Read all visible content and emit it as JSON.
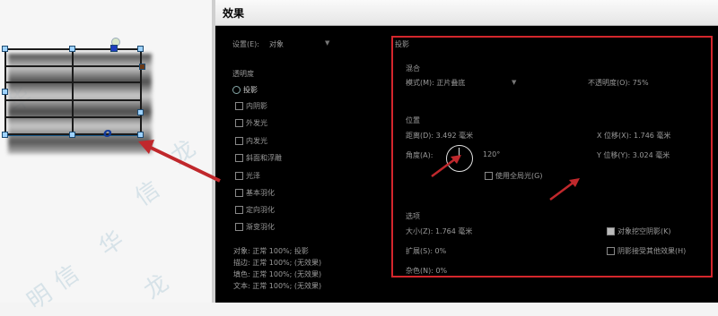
{
  "watermark": {
    "chars": [
      "华",
      "信",
      "龙",
      "华",
      "信",
      "明",
      "龙"
    ]
  },
  "dialog": {
    "title": "效果",
    "preset_label": "设置(E):",
    "preset_value": "对象",
    "left_section_label": "透明度",
    "effects": [
      "投影",
      "内阴影",
      "外发光",
      "内发光",
      "斜面和浮雕",
      "光泽",
      "基本羽化",
      "定向羽化",
      "渐变羽化"
    ],
    "summary_lines": [
      "对象: 正常 100%; 投影",
      "描边: 正常 100%; (无效果)",
      "填色: 正常 100%; (无效果)",
      "文本: 正常 100%; (无效果)"
    ],
    "panel_title": "投影",
    "blend": {
      "section": "混合",
      "mode_label": "模式(M): 正片叠底",
      "opacity_label": "不透明度(O): 75%"
    },
    "position": {
      "section": "位置",
      "distance_label": "距离(D): 3.492 毫米",
      "angle_label": "角度(A):",
      "angle_value": "120°",
      "global_light_label": "使用全局光(G)",
      "x_offset_label": "X 位移(X): 1.746 毫米",
      "y_offset_label": "Y 位移(Y): 3.024 毫米"
    },
    "options": {
      "section": "选项",
      "size_label": "大小(Z): 1.764 毫米",
      "spread_label": "扩展(S): 0%",
      "noise_label": "杂色(N): 0%",
      "knockout_label": "对象挖空阴影(K)",
      "honor_effects_label": "阴影接受其他效果(H)"
    }
  },
  "colors": {
    "highlight_box": "#d4262c",
    "arrow": "#c0282c"
  }
}
